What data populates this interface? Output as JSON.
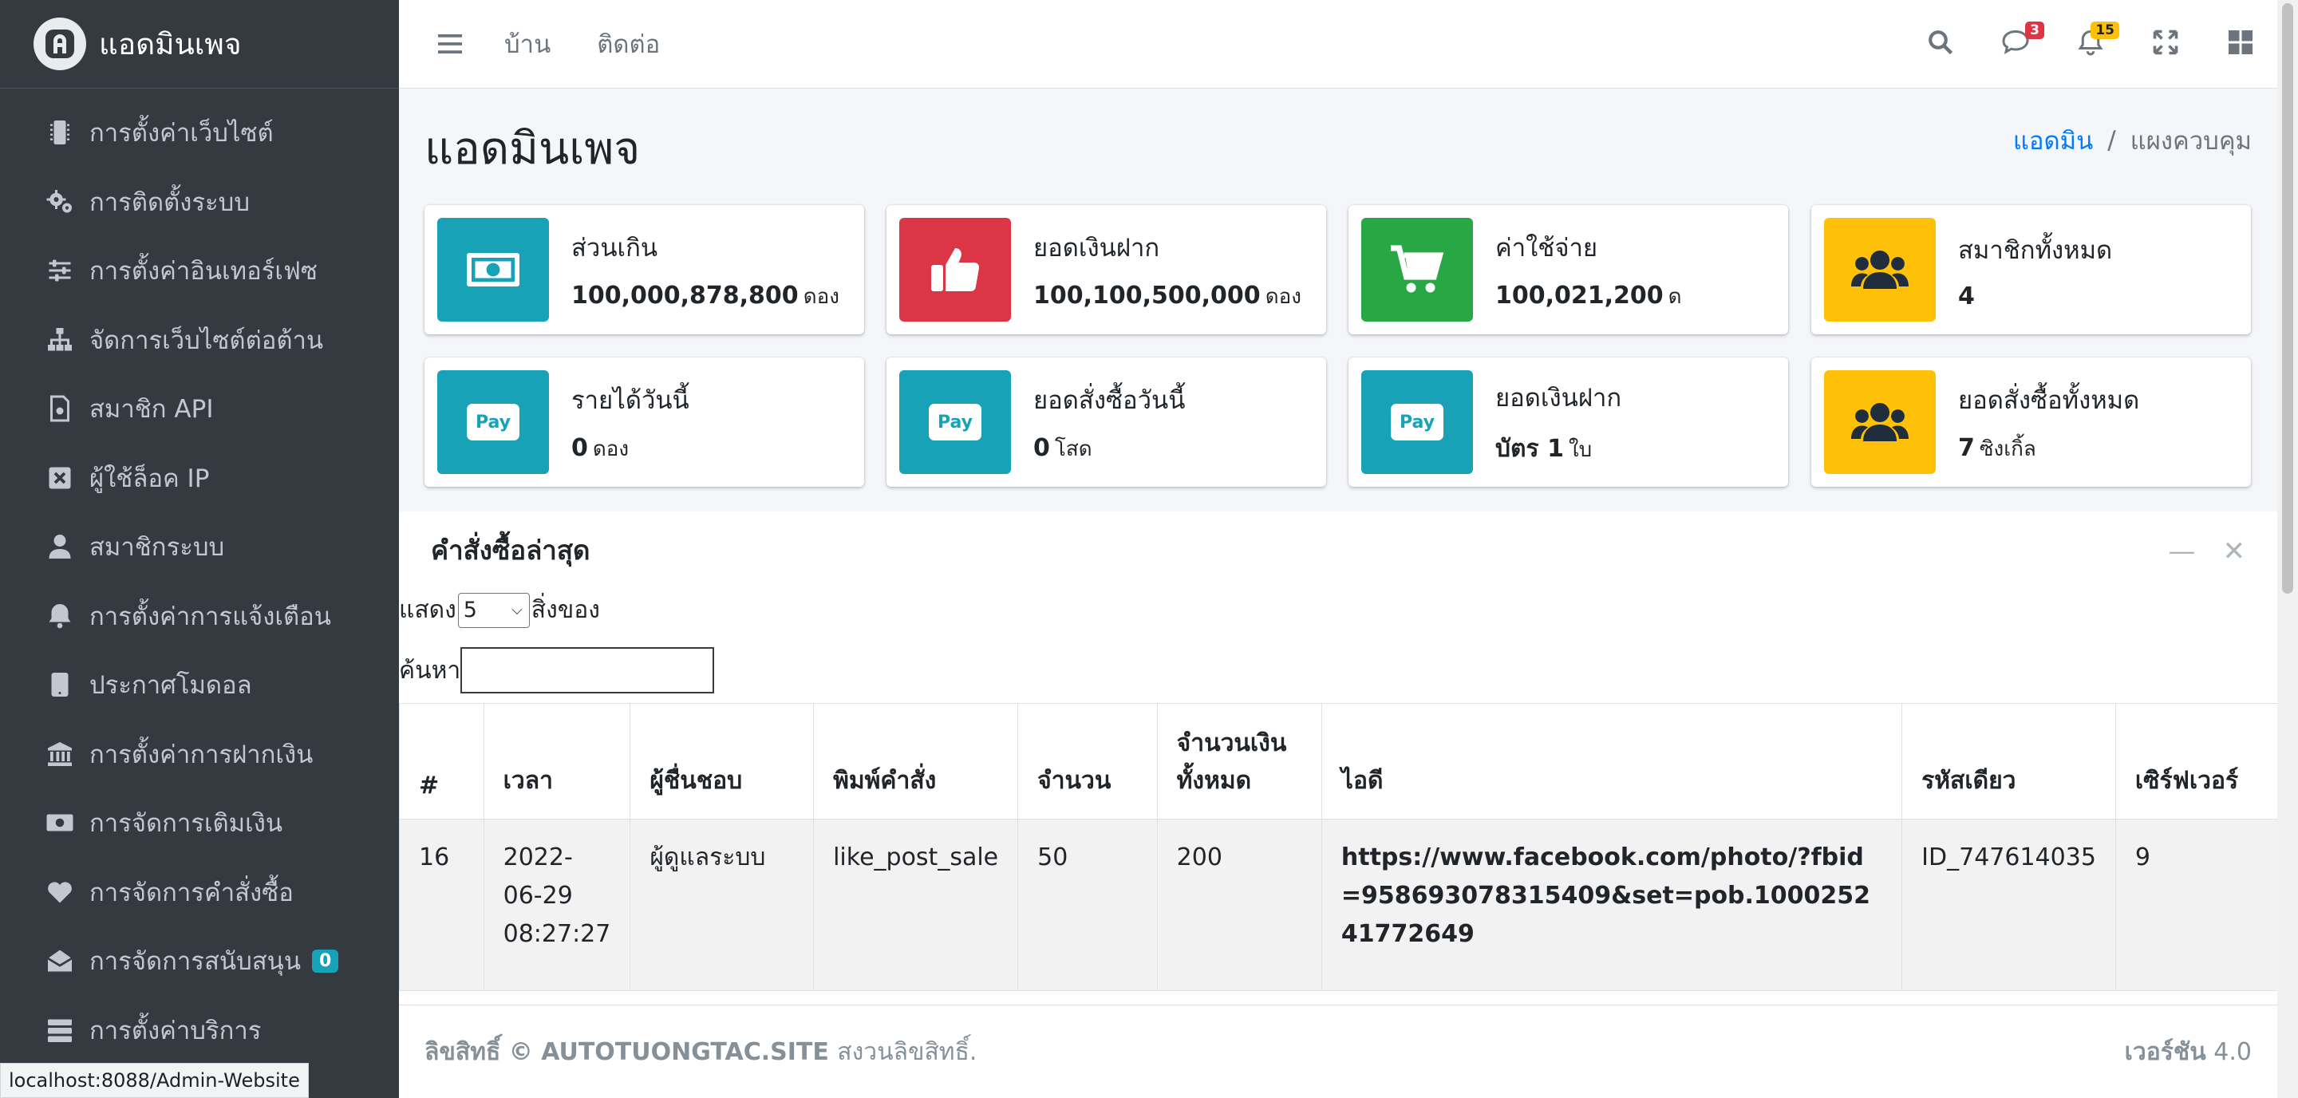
{
  "brand": {
    "name": "แอดมินเพจ"
  },
  "sidebar": {
    "items": [
      {
        "label": "การตั้งค่าเว็บไซต์",
        "icon": "microchip-icon"
      },
      {
        "label": "การติดตั้งระบบ",
        "icon": "cogs-icon"
      },
      {
        "label": "การตั้งค่าอินเทอร์เฟซ",
        "icon": "sliders-icon"
      },
      {
        "label": "จัดการเว็บไซต์ต่อต้าน",
        "icon": "sitemap-icon"
      },
      {
        "label": "สมาชิก API",
        "icon": "file-code-icon"
      },
      {
        "label": "ผู้ใช้ล็อค IP",
        "icon": "x-square-icon"
      },
      {
        "label": "สมาชิกระบบ",
        "icon": "user-icon"
      },
      {
        "label": "การตั้งค่าการแจ้งเตือน",
        "icon": "bell-icon"
      },
      {
        "label": "ประกาศโมดอล",
        "icon": "tablet-icon"
      },
      {
        "label": "การตั้งค่าการฝากเงิน",
        "icon": "bank-icon"
      },
      {
        "label": "การจัดการเติมเงิน",
        "icon": "money-bill-icon"
      },
      {
        "label": "การจัดการคำสั่งซื้อ",
        "icon": "heart-icon"
      },
      {
        "label": "การจัดการสนับสนุน",
        "icon": "envelope-open-icon",
        "badge": "0"
      },
      {
        "label": "การตั้งค่าบริการ",
        "icon": "server-icon"
      }
    ]
  },
  "status_bar": {
    "url": "localhost:8088/Admin-Website"
  },
  "topbar": {
    "links": [
      "บ้าน",
      "ติดต่อ"
    ],
    "messages_badge": "3",
    "notifications_badge": "15"
  },
  "page": {
    "title": "แอดมินเพจ",
    "breadcrumb": {
      "link": "แอดมิน",
      "sep": "/",
      "active": "แผงควบคุม"
    }
  },
  "stats": [
    {
      "label": "ส่วนเกิน",
      "value": "100,000,878,800",
      "unit": "ดอง",
      "color": "#17a2b8",
      "icon": "money-bill-icon"
    },
    {
      "label": "ยอดเงินฝาก",
      "value": "100,100,500,000",
      "unit": "ดอง",
      "color": "#dc3545",
      "icon": "thumbs-up-icon"
    },
    {
      "label": "ค่าใช้จ่าย",
      "value": "100,021,200",
      "unit": "ด",
      "color": "#28a745",
      "icon": "shopping-cart-icon"
    },
    {
      "label": "สมาชิกทั้งหมด",
      "value": "4",
      "unit": "",
      "color": "#ffc107",
      "icon": "users-icon"
    },
    {
      "label": "รายได้วันนี้",
      "value": "0",
      "unit": "ดอง",
      "color": "#17a2b8",
      "icon": "apple-pay-icon"
    },
    {
      "label": "ยอดสั่งซื้อวันนี้",
      "value": "0",
      "unit": "โสด",
      "color": "#17a2b8",
      "icon": "apple-pay-icon"
    },
    {
      "label": "ยอดเงินฝาก",
      "value": "บัตร 1",
      "unit": "ใบ",
      "color": "#17a2b8",
      "icon": "apple-pay-icon"
    },
    {
      "label": "ยอดสั่งซื้อทั้งหมด",
      "value": "7",
      "unit": "ซิงเกิ้ล",
      "color": "#ffc107",
      "icon": "users-icon"
    }
  ],
  "applepay_text": "Pay",
  "orders": {
    "title": "คำสั่งซื้อล่าสุด",
    "length_label_pre": "แสดง",
    "length_value": "5",
    "length_label_post": "สิ่งของ",
    "search_label": "ค้นหา",
    "search_value": "",
    "columns": [
      "#",
      "เวลา",
      "ผู้ชื่นชอบ",
      "พิมพ์คำสั่ง",
      "จำนวน",
      "จำนวนเงินทั้งหมด",
      "ไอดี",
      "รหัสเดียว",
      "เซิร์ฟเวอร์"
    ],
    "rows": [
      {
        "num": "16",
        "time": "2022-06-29 08:27:27",
        "user": "ผู้ดูแลระบบ",
        "type": "like_post_sale",
        "qty": "50",
        "total": "200",
        "id": "https://www.facebook.com/photo/?fbid=958693078315409&set=pob.100025241772649",
        "code": "ID_747614035",
        "server": "9"
      }
    ]
  },
  "footer": {
    "left_prefix": "ลิขสิทธิ์ ©",
    "site": "AUTOTUONGTAC.SITE",
    "left_suffix": "สงวนลิขสิทธิ์.",
    "version_label": "เวอร์ชัน",
    "version": "4.0"
  }
}
